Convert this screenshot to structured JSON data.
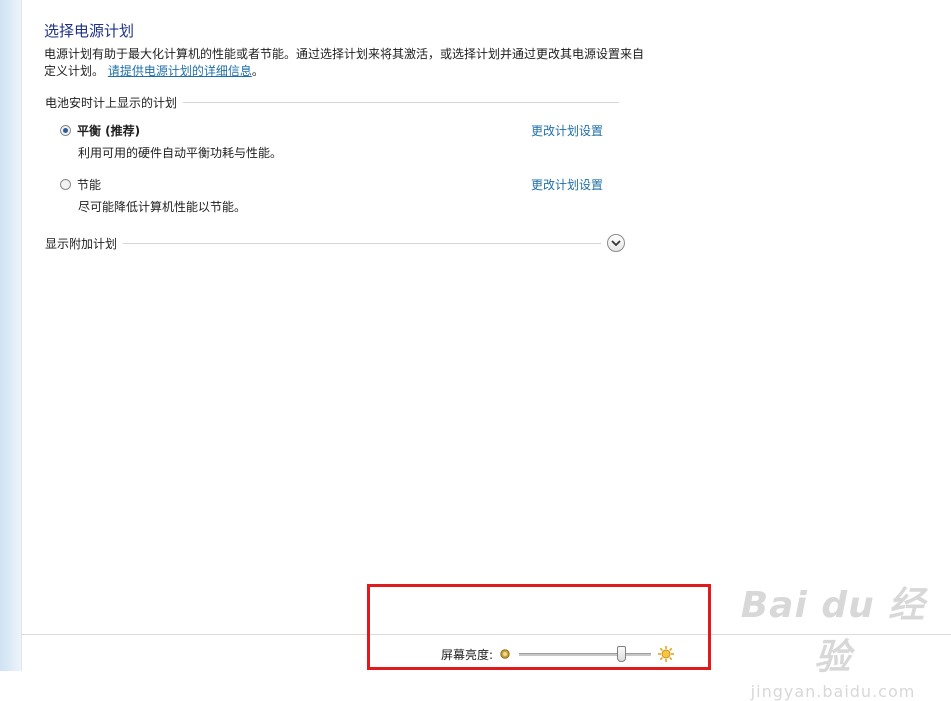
{
  "page": {
    "title": "选择电源计划",
    "description": "电源计划有助于最大化计算机的性能或者节能。通过选择计划来将其激活，或选择计划并通过更改其电源设置来自定义计划。",
    "info_link": "请提供电源计划的详细信息"
  },
  "battery_section": {
    "label": "电池安时计上显示的计划",
    "plans": [
      {
        "name": "平衡 (推荐)",
        "description": "利用可用的硬件自动平衡功耗与性能。",
        "change_link": "更改计划设置",
        "selected": true
      },
      {
        "name": "节能",
        "description": "尽可能降低计算机性能以节能。",
        "change_link": "更改计划设置",
        "selected": false
      }
    ]
  },
  "extra_plans": {
    "label": "显示附加计划",
    "expand_icon": "chevron-down-icon"
  },
  "brightness": {
    "label": "屏幕亮度:",
    "level": 0.77,
    "min_icon": "dim-sun-icon",
    "max_icon": "bright-sun-icon"
  },
  "watermark": {
    "logo": "Bai du 经验",
    "url": "jingyan.baidu.com"
  },
  "colors": {
    "title": "#1e3287",
    "link": "#1e6fa8",
    "highlight": "#e11b1b",
    "radio_selected": "#2e5c99"
  }
}
